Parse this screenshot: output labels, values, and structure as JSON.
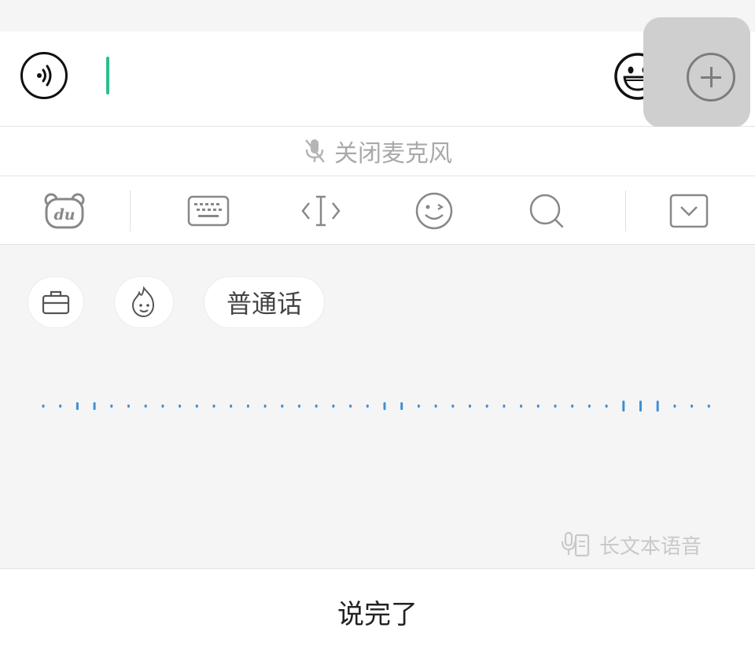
{
  "input_bar": {
    "text_value": ""
  },
  "mic": {
    "label": "关闭麦克风"
  },
  "toolbar": {
    "logo_text": "du",
    "items": [
      "du-logo-icon",
      "keyboard-icon",
      "cursor-move-icon",
      "emoji-icon",
      "search-icon",
      "collapse-icon"
    ]
  },
  "chips": {
    "language_label": "普通话"
  },
  "long_voice": {
    "label": "长文本语音"
  },
  "done": {
    "label": "说完了"
  },
  "colors": {
    "accent": "#2bbf8a",
    "wave": "#3f8fd6",
    "muted": "#a9a9a9"
  }
}
